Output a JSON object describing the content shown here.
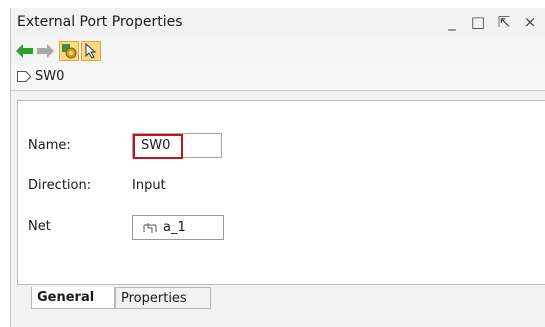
{
  "window": {
    "title": "External Port Properties",
    "controls": [
      {
        "name": "minimize",
        "glyph": "_"
      },
      {
        "name": "maximize",
        "glyph": "□"
      },
      {
        "name": "float",
        "glyph": "⇱"
      },
      {
        "name": "close",
        "glyph": "×"
      }
    ]
  },
  "toolbar": {
    "back_icon": "arrow-left-green-icon",
    "forward_icon": "arrow-right-gray-icon",
    "auto_update_icon": "gear-toggle-icon",
    "select_icon": "cursor-toggle-icon"
  },
  "breadcrumb": {
    "label": "SW0",
    "icon": "port-icon"
  },
  "form": {
    "name_label": "Name:",
    "name_value": "SW0",
    "direction_label": "Direction:",
    "direction_value": "Input",
    "net_label": "Net",
    "net_value": "a_1",
    "net_icon": "net-icon"
  },
  "tabs": [
    {
      "label": "General",
      "active": true
    },
    {
      "label": "Properties",
      "active": false
    }
  ],
  "colors": {
    "highlight_red": "#c0151b",
    "toggle_yellow": "#fbd78a",
    "arrow_green": "#2e9e2e"
  }
}
